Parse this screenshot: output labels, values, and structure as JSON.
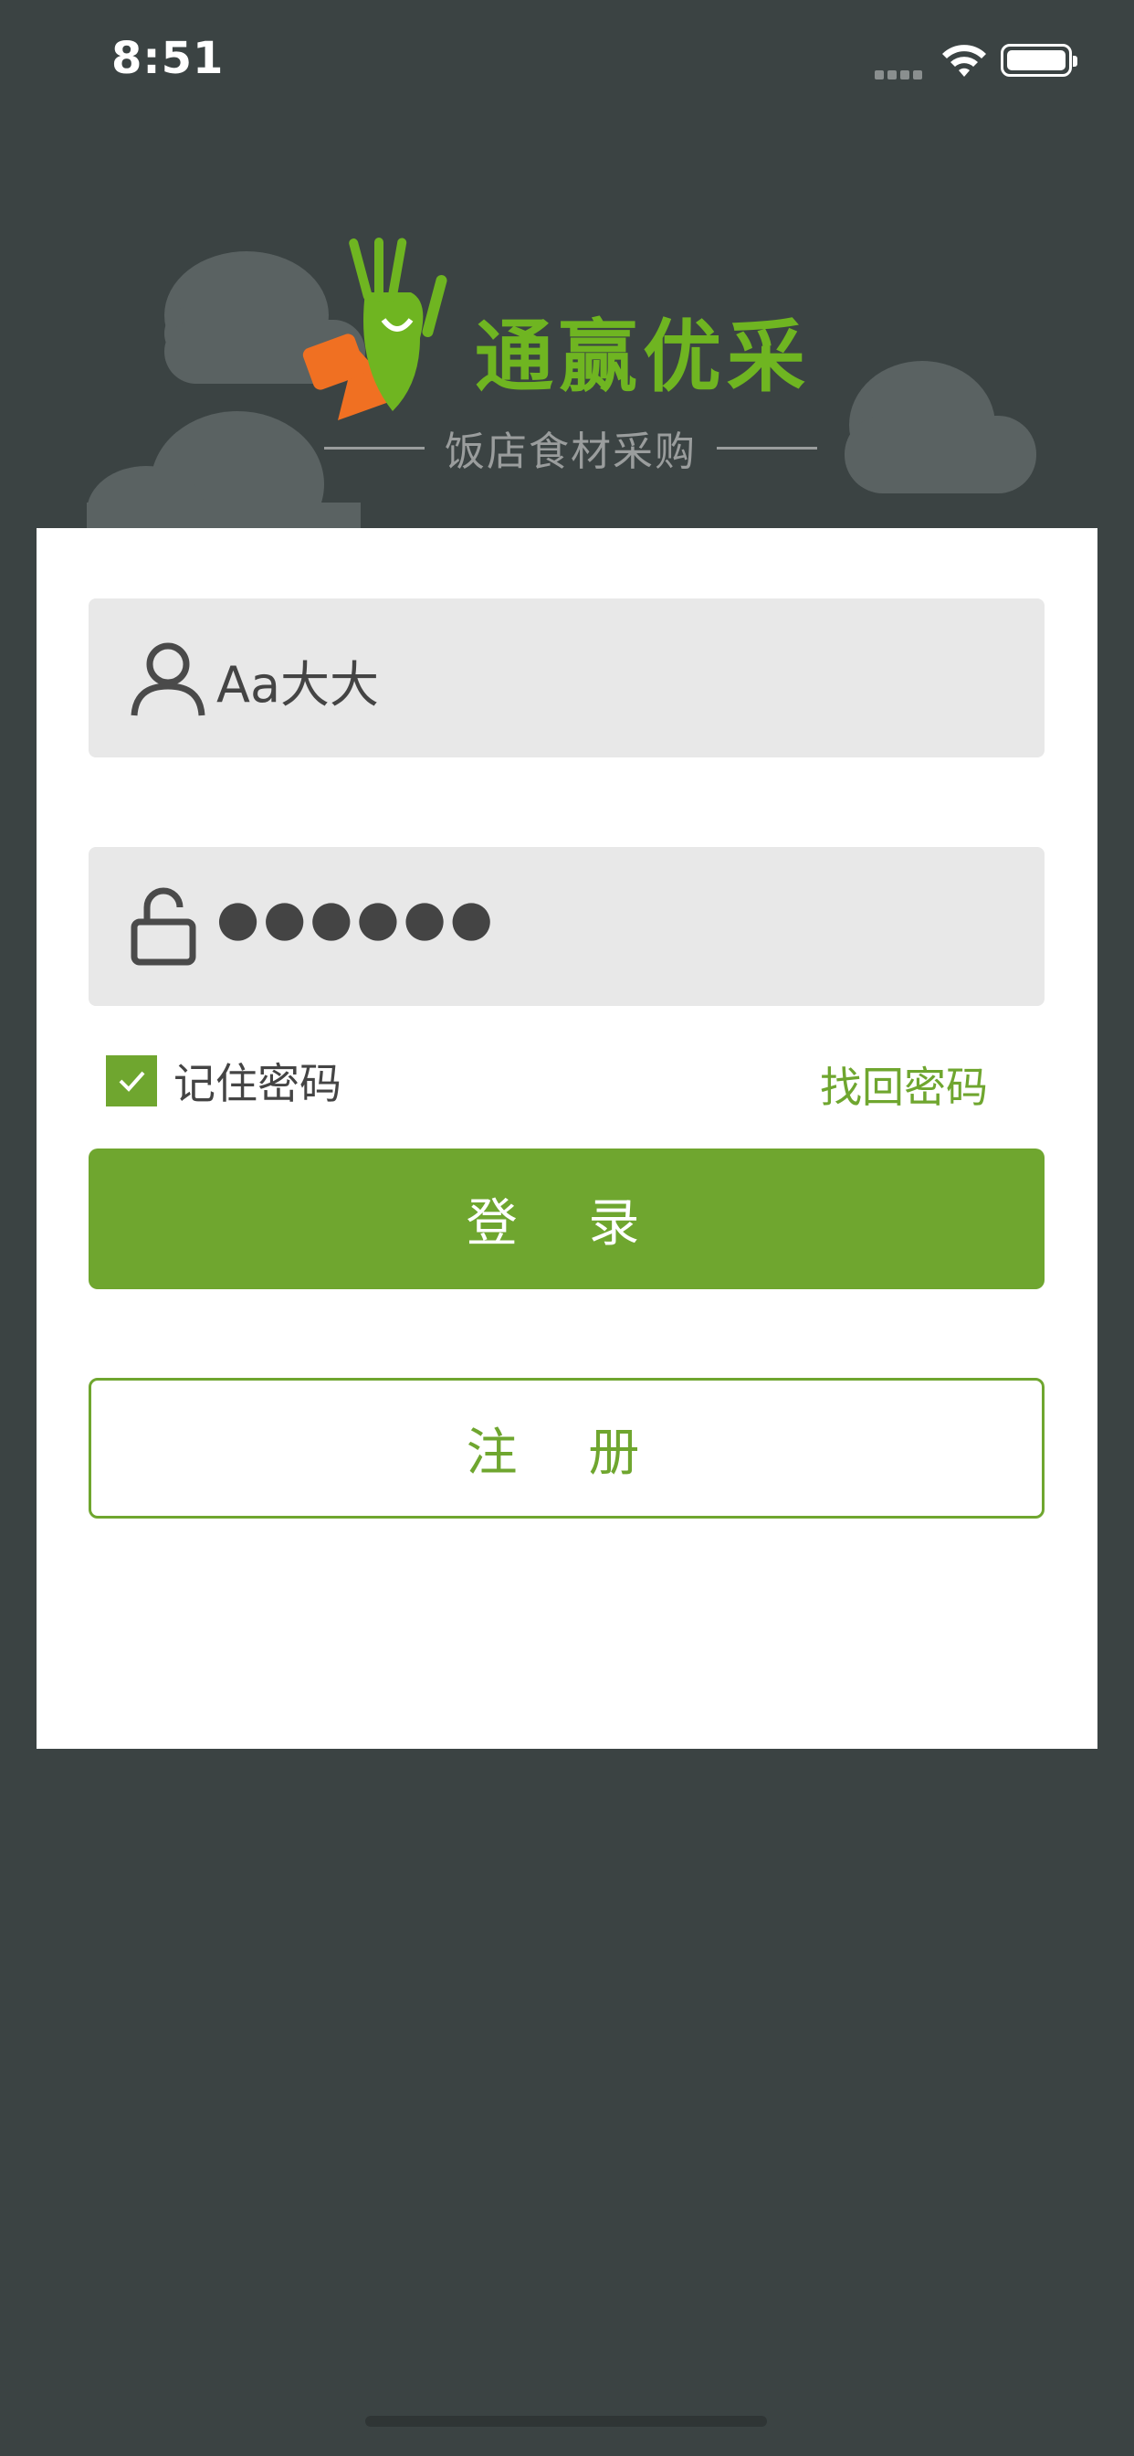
{
  "status_bar": {
    "time": "8:51"
  },
  "brand": {
    "name": "通赢优采",
    "tagline": "饭店食材采购"
  },
  "login_form": {
    "username_value": "Aa大大",
    "password_value": "●●●●●●",
    "remember_label": "记住密码",
    "remember_checked": true,
    "forgot_label": "找回密码",
    "login_label": "登 录",
    "register_label": "注 册"
  },
  "colors": {
    "background": "#3b4343",
    "accent": "#6fa62f",
    "field_bg": "#e8e8e8",
    "card_bg": "#ffffff"
  },
  "icons": [
    "user-icon",
    "unlock-icon",
    "check-icon",
    "wifi-icon",
    "battery-icon",
    "signal-icon",
    "mascot-logo-icon"
  ]
}
